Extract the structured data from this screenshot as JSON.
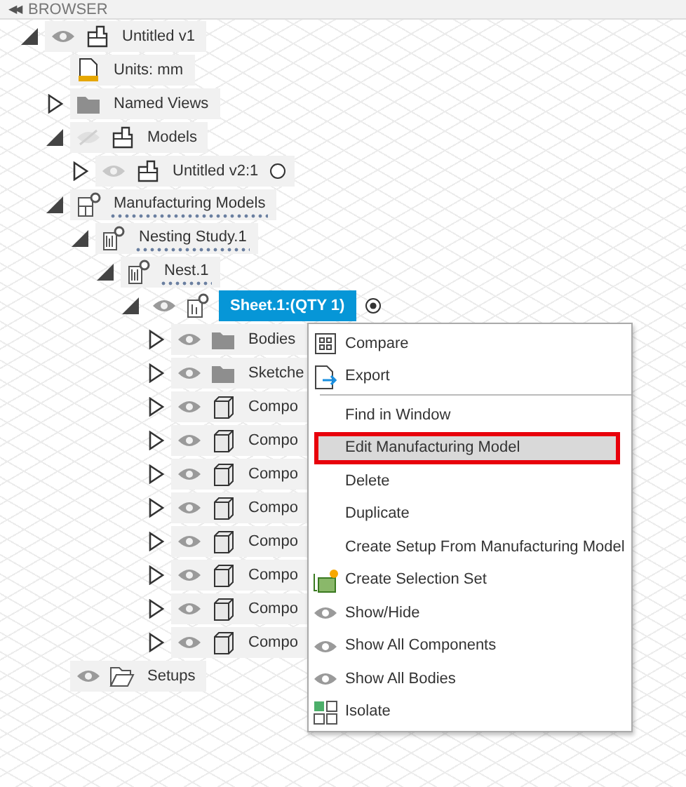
{
  "panel": {
    "title": "BROWSER",
    "collapse_glyph": "◀◀"
  },
  "tree": [
    {
      "label": "Untitled v1",
      "kind": "component",
      "expanded": true,
      "visible": true,
      "children": [
        {
          "label": "Units: mm",
          "kind": "units"
        },
        {
          "label": "Named Views",
          "kind": "folder",
          "expanded": false
        },
        {
          "label": "Models",
          "kind": "component",
          "expanded": true,
          "visible": false,
          "children": [
            {
              "label": "Untitled v2:1",
              "kind": "component",
              "expanded": false,
              "visible": true,
              "radio": false
            }
          ]
        },
        {
          "label": "Manufacturing Models",
          "kind": "mfg",
          "expanded": true,
          "children": [
            {
              "label": "Nesting Study.1",
              "kind": "nest",
              "expanded": true,
              "children": [
                {
                  "label": "Nest.1",
                  "kind": "nest",
                  "expanded": true,
                  "children": [
                    {
                      "label": "Sheet.1:(QTY 1)",
                      "kind": "sheet",
                      "expanded": true,
                      "visible": true,
                      "selected": true,
                      "radio": true,
                      "children": [
                        {
                          "label": "Bodies",
                          "kind": "folder",
                          "expanded": false,
                          "visible": true
                        },
                        {
                          "label": "Sketche",
                          "kind": "folder",
                          "expanded": false,
                          "visible": true
                        },
                        {
                          "label": "Compo",
                          "kind": "body",
                          "expanded": false,
                          "visible": true
                        },
                        {
                          "label": "Compo",
                          "kind": "body",
                          "expanded": false,
                          "visible": true
                        },
                        {
                          "label": "Compo",
                          "kind": "body",
                          "expanded": false,
                          "visible": true
                        },
                        {
                          "label": "Compo",
                          "kind": "body",
                          "expanded": false,
                          "visible": true
                        },
                        {
                          "label": "Compo",
                          "kind": "body",
                          "expanded": false,
                          "visible": true
                        },
                        {
                          "label": "Compo",
                          "kind": "body",
                          "expanded": false,
                          "visible": true
                        },
                        {
                          "label": "Compo",
                          "kind": "body",
                          "expanded": false,
                          "visible": true
                        },
                        {
                          "label": "Compo",
                          "kind": "body",
                          "expanded": false,
                          "visible": true
                        }
                      ]
                    }
                  ]
                }
              ]
            }
          ]
        },
        {
          "label": "Setups",
          "kind": "setups",
          "visible": true
        }
      ]
    }
  ],
  "context_menu": [
    {
      "label": "Compare",
      "kind": "compare",
      "selected": false
    },
    {
      "label": "Export",
      "kind": "export",
      "selected": false,
      "divider_after": true
    },
    {
      "label": "Find in Window",
      "selected": false
    },
    {
      "label": "Edit Manufacturing Model",
      "selected": true
    },
    {
      "label": "Delete",
      "selected": false
    },
    {
      "label": "Duplicate",
      "selected": false
    },
    {
      "label": "Create Setup From Manufacturing Model",
      "selected": false
    },
    {
      "label": "Create Selection Set",
      "kind": "selection",
      "selected": false
    },
    {
      "label": "Show/Hide",
      "kind": "visibility",
      "selected": false
    },
    {
      "label": "Show All Components",
      "kind": "visibility",
      "selected": false
    },
    {
      "label": "Show All Bodies",
      "kind": "visibility",
      "selected": false
    },
    {
      "label": "Isolate",
      "kind": "isolate",
      "selected": false
    }
  ]
}
